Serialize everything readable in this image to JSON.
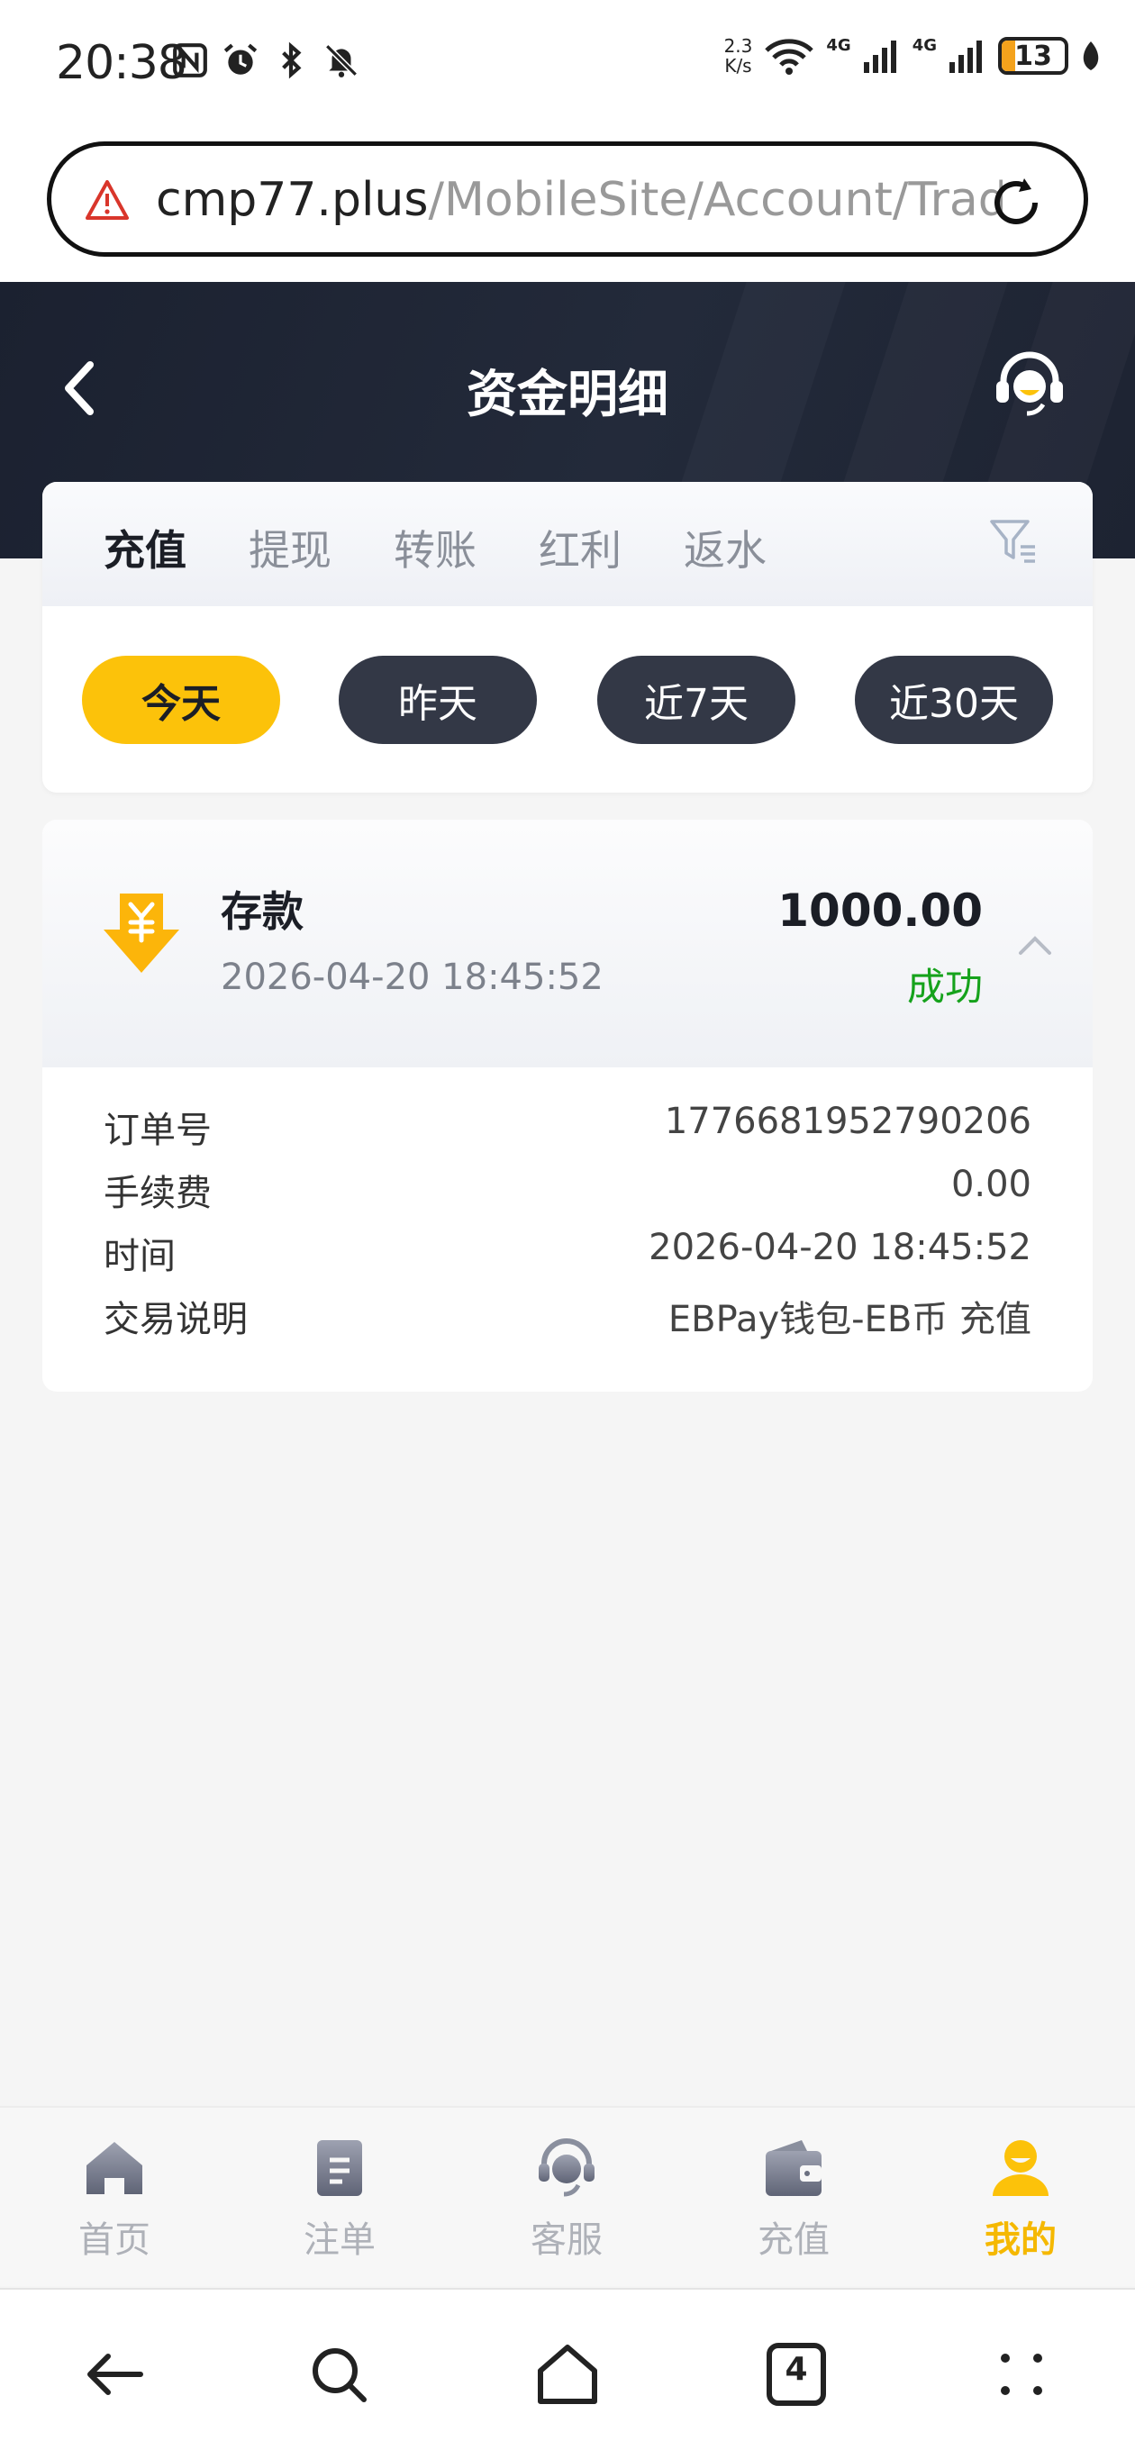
{
  "status_bar": {
    "time": "20:38",
    "net_speed_value": "2.3",
    "net_speed_unit": "K/s",
    "signal_a": "4G",
    "signal_b": "4G",
    "battery_level": "13"
  },
  "browser": {
    "url_domain": "cmp77.plus",
    "url_path": "/MobileSite/Account/Trade"
  },
  "header": {
    "title": "资金明细"
  },
  "tabs": [
    {
      "label": "充值",
      "active": true
    },
    {
      "label": "提现",
      "active": false
    },
    {
      "label": "转账",
      "active": false
    },
    {
      "label": "红利",
      "active": false
    },
    {
      "label": "返水",
      "active": false
    }
  ],
  "ranges": [
    {
      "label": "今天",
      "active": true
    },
    {
      "label": "昨天",
      "active": false
    },
    {
      "label": "近7天",
      "active": false
    },
    {
      "label": "近30天",
      "active": false
    }
  ],
  "record": {
    "type": "存款",
    "time": "2026-04-20 18:45:52",
    "amount": "1000.00",
    "status": "成功",
    "details": [
      {
        "label": "订单号",
        "value": "1776681952790206"
      },
      {
        "label": "手续费",
        "value": "0.00"
      },
      {
        "label": "时间",
        "value": "2026-04-20 18:45:52"
      },
      {
        "label": "交易说明",
        "value": "EBPay钱包-EB币 充值"
      }
    ]
  },
  "bottom_nav": [
    {
      "label": "首页",
      "icon": "home-icon",
      "active": false
    },
    {
      "label": "注单",
      "icon": "bet-slip-icon",
      "active": false
    },
    {
      "label": "客服",
      "icon": "customer-service-icon",
      "active": false
    },
    {
      "label": "充值",
      "icon": "wallet-icon",
      "active": false
    },
    {
      "label": "我的",
      "icon": "user-icon",
      "active": true
    }
  ],
  "system_nav": {
    "tab_count": "4"
  },
  "colors": {
    "accent": "#fcc20a",
    "header_bg": "#1b2130",
    "success": "#16a21c",
    "pill_dark": "#333846"
  }
}
